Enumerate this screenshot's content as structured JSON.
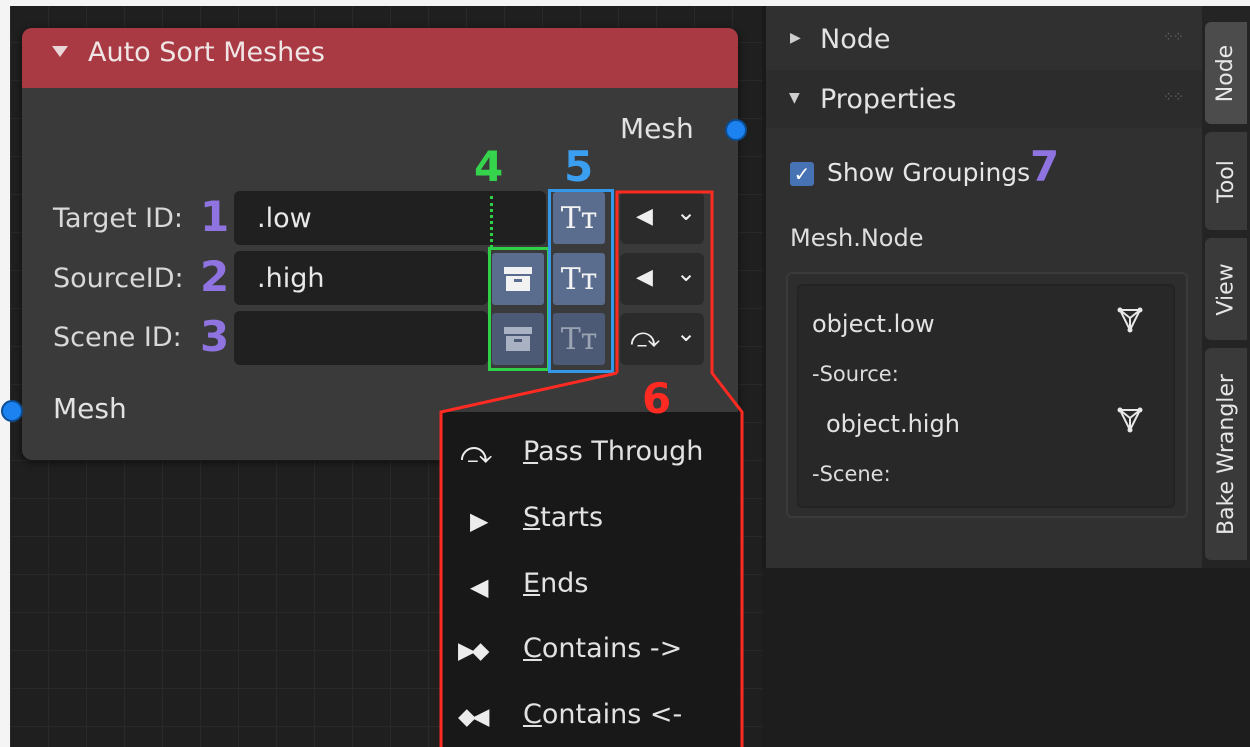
{
  "node": {
    "title": "Auto Sort Meshes",
    "output_socket": "Mesh",
    "input_socket": "Mesh",
    "rows": [
      {
        "label": "Target ID:",
        "number": "1",
        "value": ".low",
        "drop_glyph": "◀"
      },
      {
        "label": "SourceID:",
        "number": "2",
        "value": ".high",
        "drop_glyph": "◀"
      },
      {
        "label": "Scene ID:",
        "number": "3",
        "value": "",
        "drop_glyph": "⤼"
      }
    ],
    "tt_glyph": "Tт",
    "chevron": "⌄"
  },
  "annotations": {
    "a4": "4",
    "a5": "5",
    "a6": "6",
    "a7": "7"
  },
  "menu": {
    "items": [
      {
        "icon": "⤼",
        "first": "P",
        "rest": "ass Through"
      },
      {
        "icon": "▶",
        "first": "S",
        "rest": "tarts"
      },
      {
        "icon": "◀",
        "first": "E",
        "rest": "nds"
      },
      {
        "icon": "▶◆",
        "first": "C",
        "rest": "ontains ->"
      },
      {
        "icon": "◆◀",
        "first": "C",
        "rest": "ontains <-"
      }
    ]
  },
  "panel": {
    "node_header": "Node",
    "properties_header": "Properties",
    "show_groupings": "Show Groupings",
    "show_groupings_checked": true,
    "mesh_node": "Mesh.Node",
    "groups": {
      "target": "object.low",
      "source_label": "-Source:",
      "source": "object.high",
      "scene_label": "-Scene:"
    },
    "tabs": [
      "Node",
      "Tool",
      "View",
      "Bake Wrangler"
    ]
  },
  "colors": {
    "header": "#a93a44",
    "socket": "#1b82f0",
    "number": "#8f73e0",
    "annotation_green": "#2fd048",
    "annotation_blue": "#3498e8",
    "annotation_red": "#ff2a22"
  },
  "icons": {
    "collapse": "triangle-down-icon",
    "box": "archive-box-icon",
    "text_case": "text-case-icon",
    "mesh": "mesh-object-icon"
  }
}
